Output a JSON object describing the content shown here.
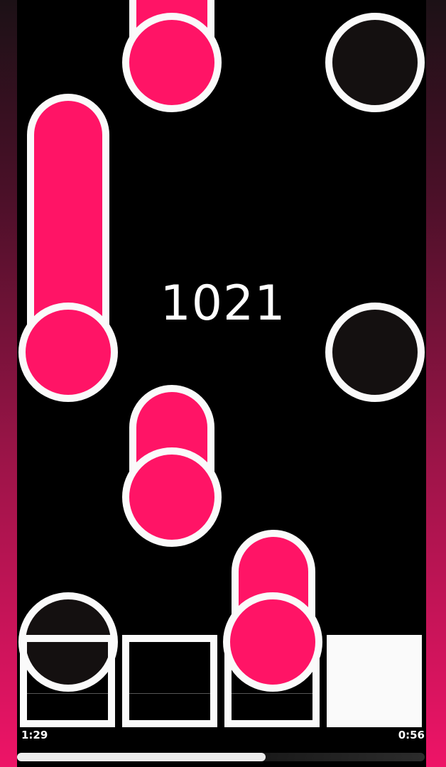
{
  "game": {
    "score": "1021",
    "elapsed_time": "1:29",
    "remaining_time": "0:56",
    "progress": 0.61,
    "pads": [
      {
        "name": "lane-1-pad",
        "lit": false
      },
      {
        "name": "lane-2-pad",
        "lit": false
      },
      {
        "name": "lane-3-pad",
        "lit": false
      },
      {
        "name": "lane-4-pad",
        "lit": true
      }
    ]
  },
  "colors": {
    "note_pink": "#ff1466",
    "note_dark": "#141010",
    "outline": "#fafafa",
    "background": "#000000"
  }
}
